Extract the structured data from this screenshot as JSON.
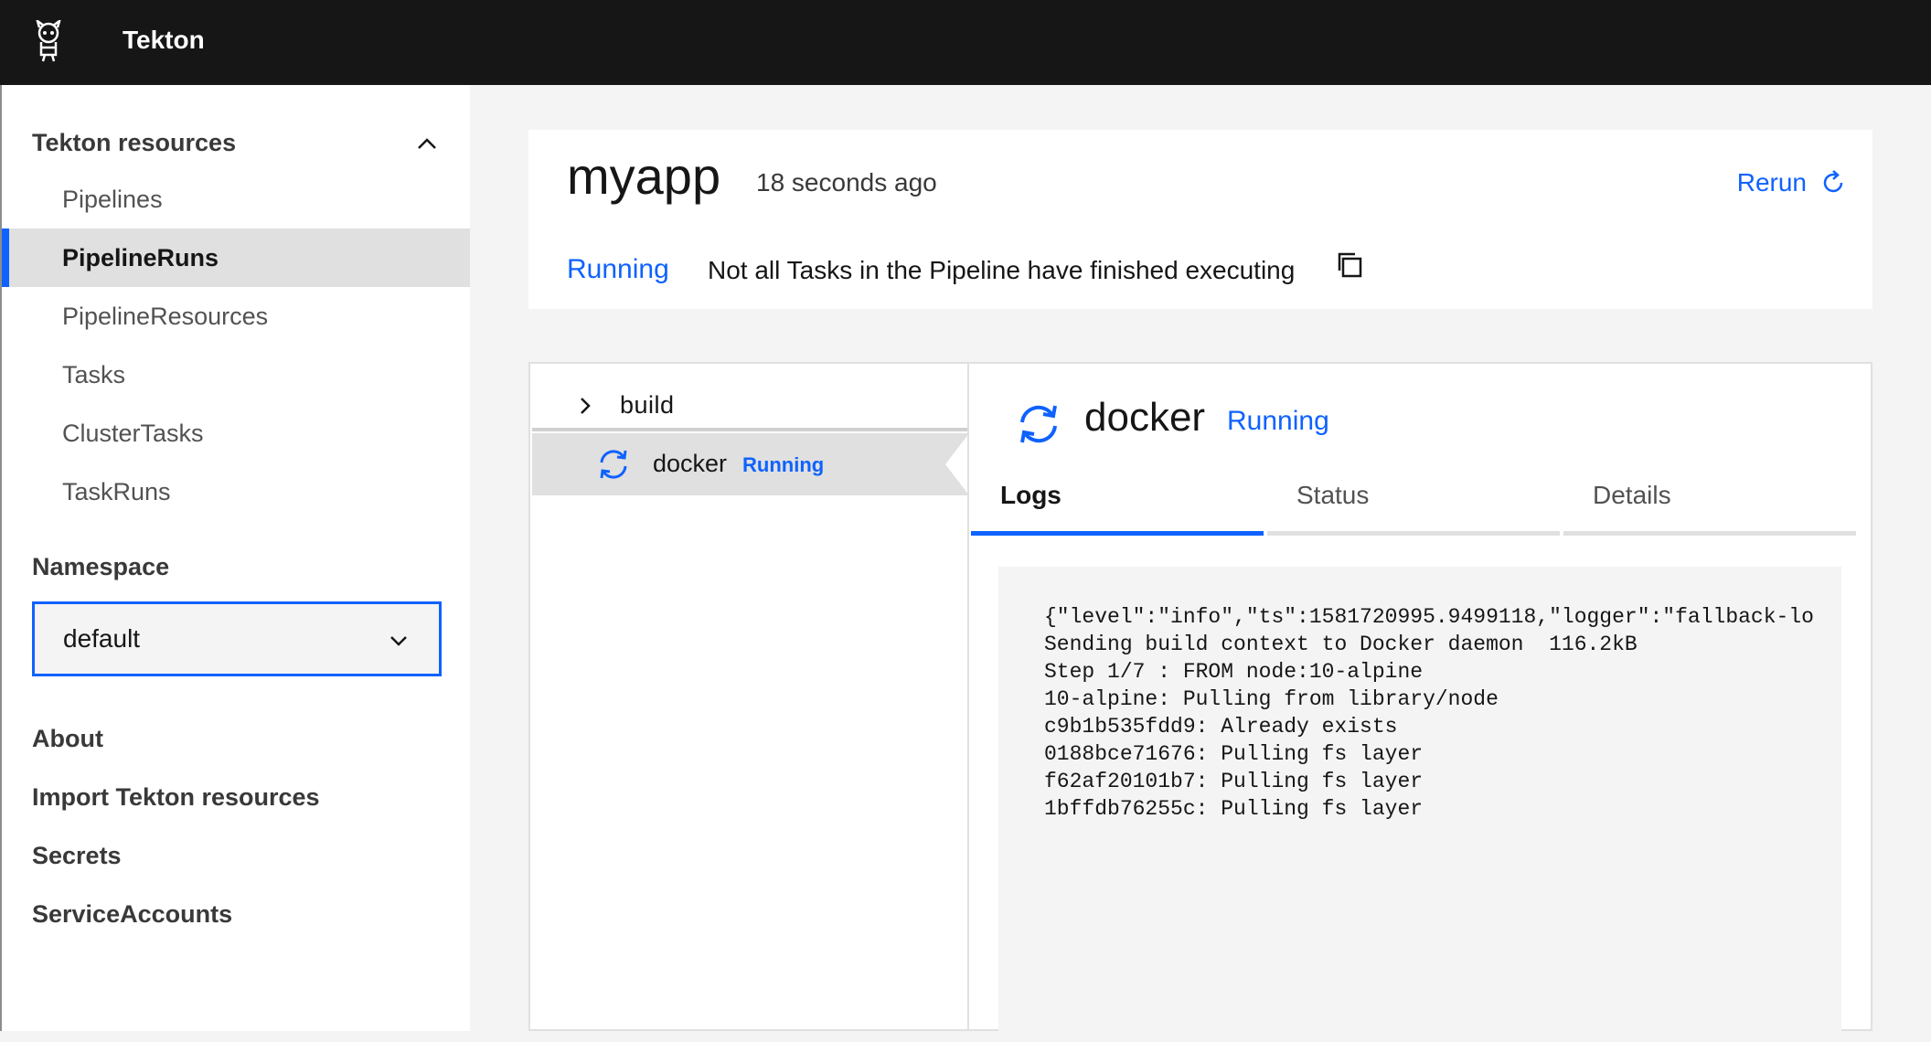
{
  "header": {
    "title": "Tekton"
  },
  "sidebar": {
    "section_title": "Tekton resources",
    "items": [
      {
        "label": "Pipelines"
      },
      {
        "label": "PipelineRuns",
        "active": true
      },
      {
        "label": "PipelineResources"
      },
      {
        "label": "Tasks"
      },
      {
        "label": "ClusterTasks"
      },
      {
        "label": "TaskRuns"
      }
    ],
    "namespace_label": "Namespace",
    "namespace_value": "default",
    "links": [
      {
        "label": "About"
      },
      {
        "label": "Import Tekton resources"
      },
      {
        "label": "Secrets"
      },
      {
        "label": "ServiceAccounts"
      }
    ]
  },
  "run": {
    "name": "myapp",
    "time": "18 seconds ago",
    "rerun_label": "Rerun",
    "status": "Running",
    "message": "Not all Tasks in the Pipeline have finished executing"
  },
  "tree": {
    "task": "build",
    "step": {
      "name": "docker",
      "status": "Running"
    }
  },
  "detail": {
    "name": "docker",
    "status": "Running",
    "tabs": [
      {
        "label": "Logs",
        "active": true
      },
      {
        "label": "Status"
      },
      {
        "label": "Details"
      }
    ],
    "logs": [
      "{\"level\":\"info\",\"ts\":1581720995.9499118,\"logger\":\"fallback-lo",
      "Sending build context to Docker daemon  116.2kB",
      "Step 1/7 : FROM node:10-alpine",
      "10-alpine: Pulling from library/node",
      "c9b1b535fdd9: Already exists",
      "0188bce71676: Pulling fs layer",
      "f62af20101b7: Pulling fs layer",
      "1bffdb76255c: Pulling fs layer"
    ]
  },
  "colors": {
    "accent": "#0f62fe",
    "header_bg": "#161616",
    "page_bg": "#f4f4f4"
  }
}
